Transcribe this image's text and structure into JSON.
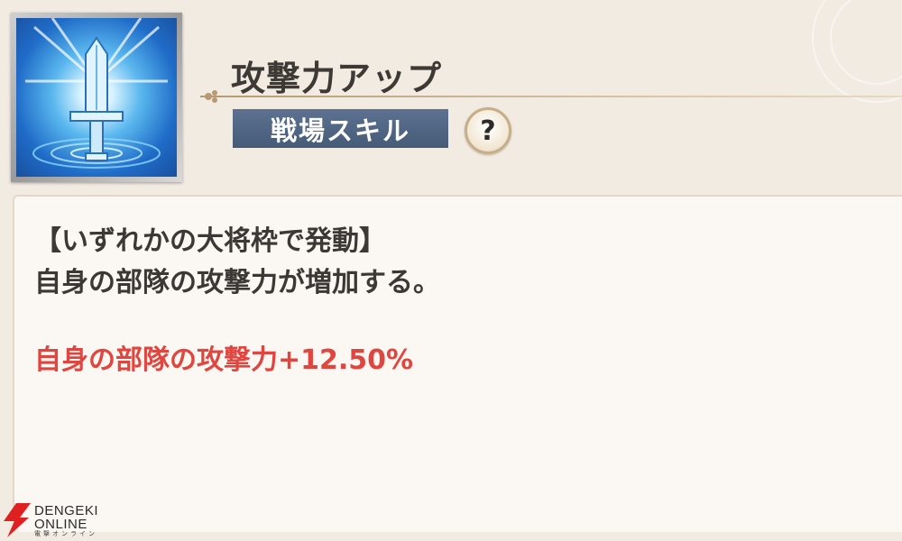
{
  "skill": {
    "name": "攻撃力アップ",
    "category": "戦場スキル",
    "help_symbol": "?"
  },
  "description": {
    "condition": "【いずれかの大将枠で発動】",
    "summary": "自身の部隊の攻撃力が増加する。",
    "effect": "自身の部隊の攻撃力+12.50%"
  },
  "watermark": {
    "line1": "DENGEKI",
    "line2": "ONLINE",
    "line3": "電撃オンライン"
  },
  "colors": {
    "effect_text": "#e0463f",
    "badge_bg": "#4f6483",
    "panel_bg": "#fbf8f3"
  },
  "icons": {
    "skill_icon": "sword-icon",
    "help": "question-icon",
    "watermark": "dengeki-logo-icon"
  }
}
